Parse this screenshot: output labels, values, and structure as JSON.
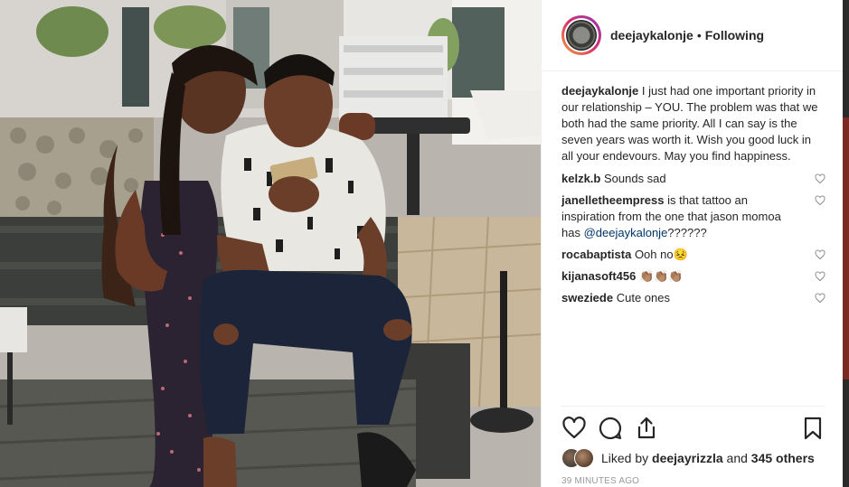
{
  "post": {
    "username": "deejaykalonje",
    "separator": "•",
    "follow_status": "Following",
    "caption_user": "deejaykalonje",
    "caption_text": "I just had one important priority in our relationship – YOU. The problem was that we both had the same priority. All I can say is the seven years was worth it. Wish you good luck in all your endevours. May you find happiness."
  },
  "comments": [
    {
      "user": "kelzk.b",
      "text": "Sounds sad"
    },
    {
      "user": "janelletheempress",
      "text": "is that tattoo an inspiration from the one that jason momoa has",
      "mention": "@deejaykalonje",
      "tail": "??????"
    },
    {
      "user": "rocabaptista",
      "text": "Ooh no",
      "emoji": "😣"
    },
    {
      "user": "kijanasoft456",
      "text": "",
      "emoji": "👏🏽👏🏽👏🏽"
    },
    {
      "user": "sweziede",
      "text": "Cute ones"
    }
  ],
  "actions": {
    "like_icon": "heart-icon",
    "comment_icon": "comment-bubble-icon",
    "share_icon": "share-icon",
    "save_icon": "bookmark-icon"
  },
  "likes": {
    "prefix": "Liked by",
    "user": "deejayrizzla",
    "middle": "and",
    "count_text": "345 others"
  },
  "timestamp": "39 minutes ago",
  "colors": {
    "text": "#262626",
    "mention": "#003569",
    "muted": "#999999",
    "divider": "#efefef"
  }
}
